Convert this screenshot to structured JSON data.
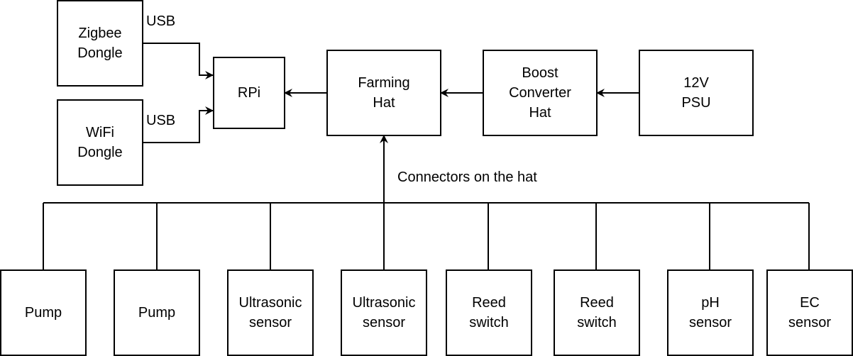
{
  "diagram": {
    "top_row": {
      "zigbee": "Zigbee\nDongle",
      "wifi": "WiFi\nDongle",
      "rpi": "RPi",
      "farming_hat": "Farming\nHat",
      "boost": "Boost\nConverter\nHat",
      "psu": "12V\nPSU"
    },
    "edge_labels": {
      "usb_zigbee": "USB",
      "usb_wifi": "USB",
      "connectors": "Connectors on the hat"
    },
    "peripherals": [
      {
        "label": "Pump"
      },
      {
        "label": "Pump"
      },
      {
        "label": "Ultrasonic\nsensor"
      },
      {
        "label": "Ultrasonic\nsensor"
      },
      {
        "label": "Reed\nswitch"
      },
      {
        "label": "Reed\nswitch"
      },
      {
        "label": "pH\nsensor"
      },
      {
        "label": "EC\nsensor"
      }
    ],
    "edges": [
      {
        "from": "zigbee",
        "to": "rpi",
        "label": "USB"
      },
      {
        "from": "wifi",
        "to": "rpi",
        "label": "USB"
      },
      {
        "from": "farming_hat",
        "to": "rpi"
      },
      {
        "from": "boost",
        "to": "farming_hat"
      },
      {
        "from": "psu",
        "to": "boost"
      },
      {
        "from": "peripherals",
        "to": "farming_hat",
        "label": "Connectors on the hat"
      }
    ]
  }
}
